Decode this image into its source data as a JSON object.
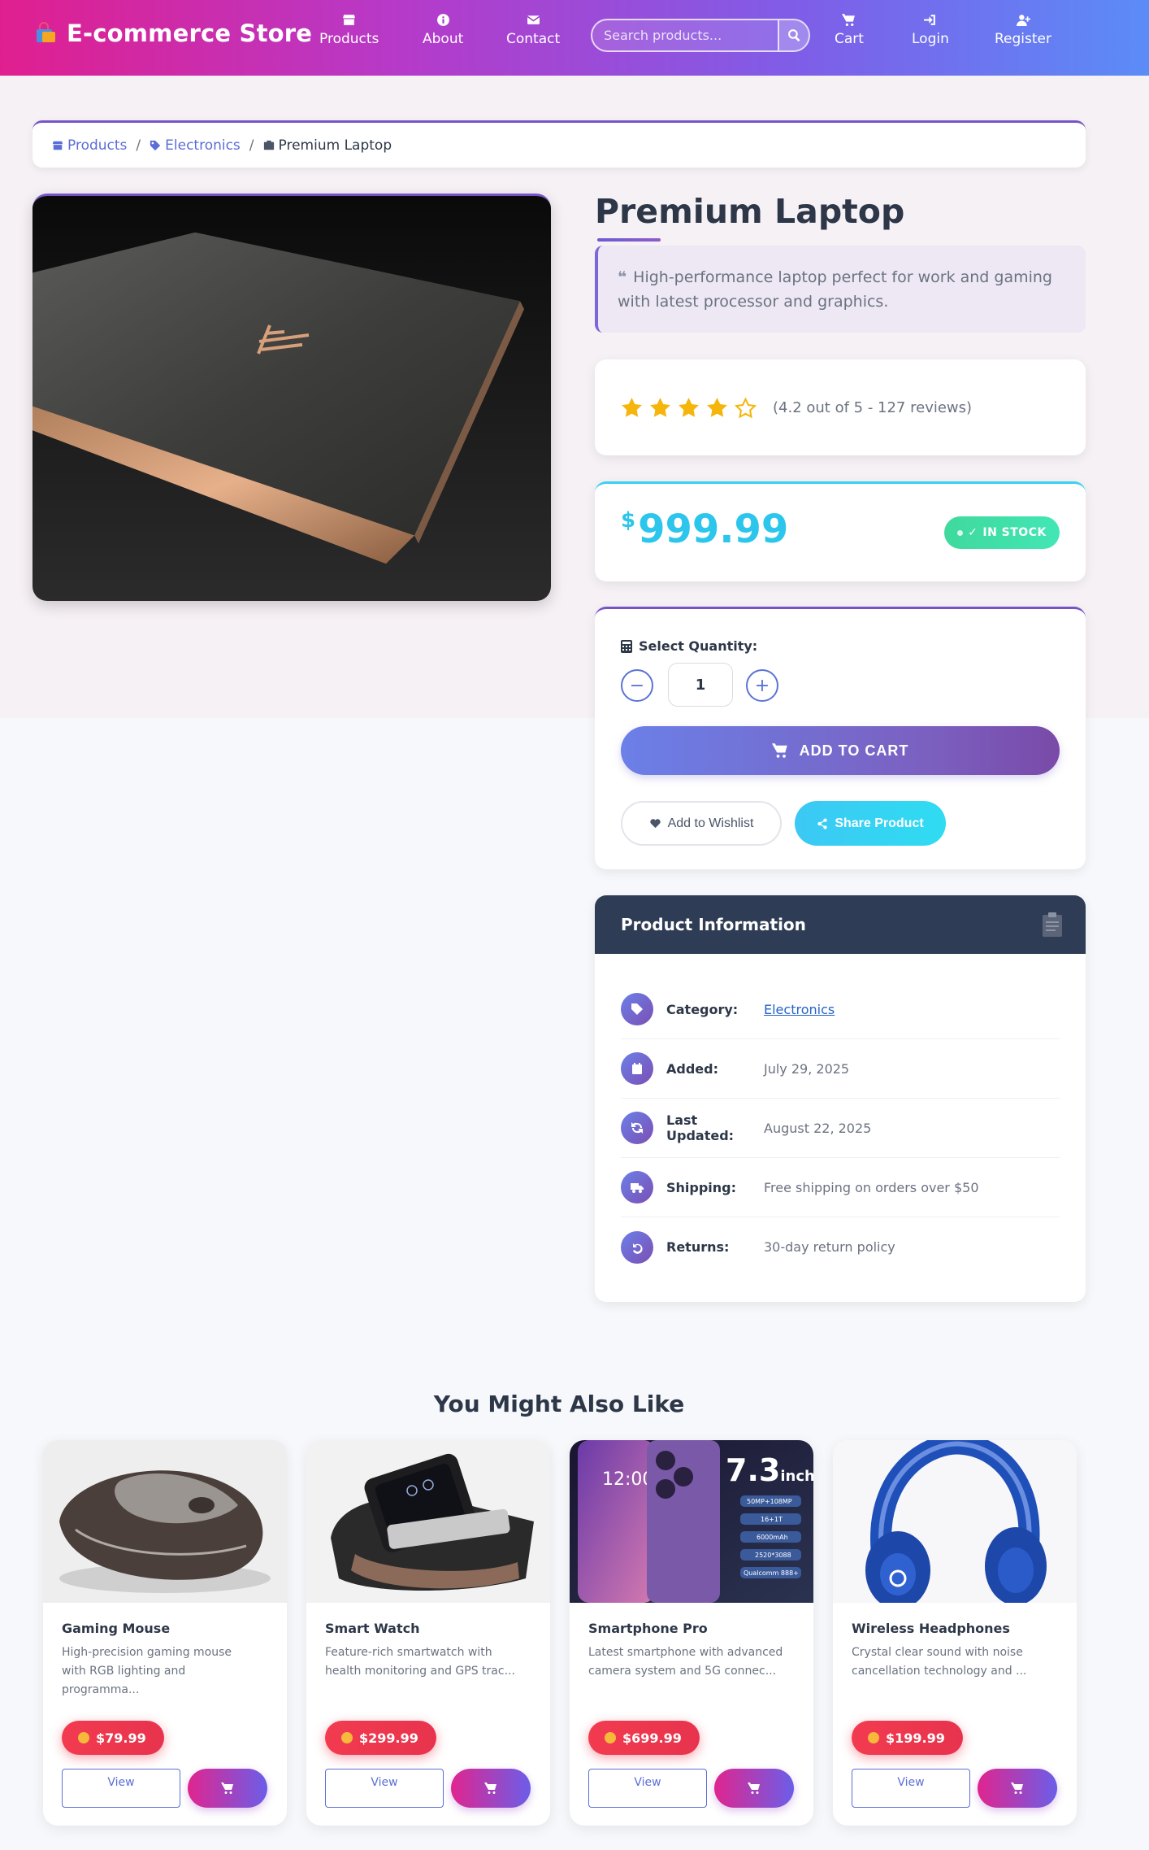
{
  "nav": {
    "brand": "E-commerce Store",
    "items": [
      {
        "label": "Products",
        "icon": "store-icon"
      },
      {
        "label": "About",
        "icon": "info-icon"
      },
      {
        "label": "Contact",
        "icon": "envelope-icon"
      },
      {
        "label": "Cart",
        "icon": "cart-icon"
      },
      {
        "label": "Login",
        "icon": "login-icon"
      },
      {
        "label": "Register",
        "icon": "user-plus-icon"
      }
    ],
    "search_placeholder": "Search products..."
  },
  "breadcrumb": {
    "products": "Products",
    "category": "Electronics",
    "current": "Premium Laptop"
  },
  "product": {
    "title": "Premium Laptop",
    "description": "High-performance laptop perfect for work and gaming with latest processor and graphics.",
    "rating": 4.2,
    "rating_text": "(4.2 out of 5 - 127 reviews)",
    "currency": "$",
    "price": "999.99",
    "stock": "IN STOCK",
    "quantity_label": "Select Quantity:",
    "quantity": "1",
    "add_to_cart": "ADD TO CART",
    "wishlist": "Add to Wishlist",
    "share": "Share Product"
  },
  "info": {
    "title": "Product Information",
    "rows": [
      {
        "key": "Category:",
        "value": "Electronics"
      },
      {
        "key": "Added:",
        "value": "July 29, 2025"
      },
      {
        "key": "Last Updated:",
        "value": "August 22, 2025"
      },
      {
        "key": "Shipping:",
        "value": "Free shipping on orders over $50"
      },
      {
        "key": "Returns:",
        "value": "30-day return policy"
      }
    ]
  },
  "recommendations": {
    "title": "You Might Also Like",
    "view_label": "View",
    "items": [
      {
        "name": "Gaming Mouse",
        "desc": "High-precision gaming mouse with RGB lighting and programma...",
        "price": "$79.99"
      },
      {
        "name": "Smart Watch",
        "desc": "Feature-rich smartwatch with health monitoring and GPS trac...",
        "price": "$299.99"
      },
      {
        "name": "Smartphone Pro",
        "desc": "Latest smartphone with advanced camera system and 5G connec...",
        "price": "$699.99",
        "image_text": {
          "time": "12:00",
          "size": "7.3",
          "unit": "inch",
          "specs": [
            "50MP+108MP",
            "16+1T",
            "6000mAh",
            "2520*3088",
            "Qualcomm 888+"
          ]
        }
      },
      {
        "name": "Wireless Headphones",
        "desc": "Crystal clear sound with noise cancellation technology and ...",
        "price": "$199.99"
      }
    ]
  },
  "colors": {
    "accent": "#7654c8",
    "price": "#2cc6ec",
    "stock": "#3fd99d",
    "star": "#f5b50a",
    "info_header": "#2e3d55",
    "rec_price": "#f23b4f"
  }
}
